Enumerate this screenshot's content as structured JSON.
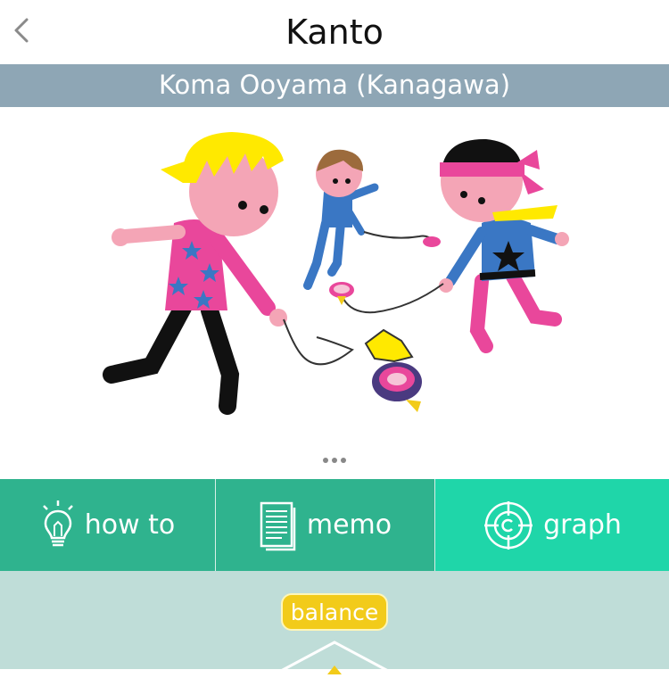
{
  "header": {
    "title": "Kanto",
    "back_icon": "chevron-left-icon"
  },
  "subheader": {
    "text": "Koma Ooyama (Kanagawa)"
  },
  "illustration": {
    "subject": "children-spinning-tops"
  },
  "pager": {
    "icon": "ellipsis-icon"
  },
  "tabs": [
    {
      "label": "how to",
      "icon": "lightbulb-icon"
    },
    {
      "label": "memo",
      "icon": "document-icon"
    },
    {
      "label": "graph",
      "icon": "target-icon"
    }
  ],
  "footer": {
    "badge": "balance"
  },
  "colors": {
    "subheader_bg": "#8ea6b5",
    "tab_bg": "#2fb38e",
    "tab_active_bg": "#1fd6a9",
    "footer_bg": "#bfddd8",
    "badge_bg": "#f2cb1a"
  }
}
